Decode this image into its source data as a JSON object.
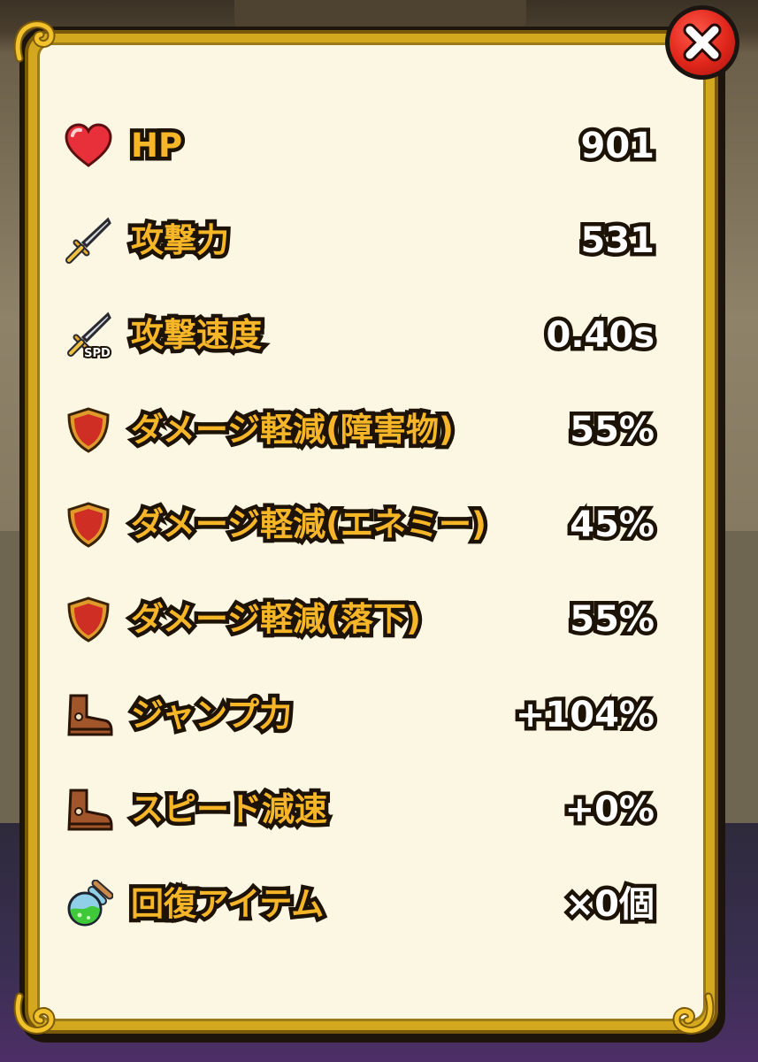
{
  "close_button": {
    "icon": "close-x-icon",
    "color": "#e0261b"
  },
  "stats": [
    {
      "icon": "heart-icon",
      "label": "HP",
      "value": "901"
    },
    {
      "icon": "sword-icon",
      "label": "攻撃力",
      "value": "531"
    },
    {
      "icon": "sword-speed-icon",
      "icon_text": "SPD",
      "label": "攻撃速度",
      "value": "0.40s"
    },
    {
      "icon": "shield-icon",
      "label": "ダメージ軽減(障害物)",
      "value": "55%"
    },
    {
      "icon": "shield-icon",
      "label": "ダメージ軽減(エネミー)",
      "value": "45%"
    },
    {
      "icon": "shield-icon",
      "label": "ダメージ軽減(落下)",
      "value": "55%"
    },
    {
      "icon": "boot-icon",
      "label": "ジャンプ力",
      "value": "+104%"
    },
    {
      "icon": "boot-icon",
      "label": "スピード減速",
      "value": "+0%"
    },
    {
      "icon": "potion-icon",
      "label": "回復アイテム",
      "value": "×0個"
    }
  ],
  "colors": {
    "label": "#f7b628",
    "value": "#ffffff",
    "panel_bg": "#fbf7e3",
    "frame": "#d4a81e"
  }
}
